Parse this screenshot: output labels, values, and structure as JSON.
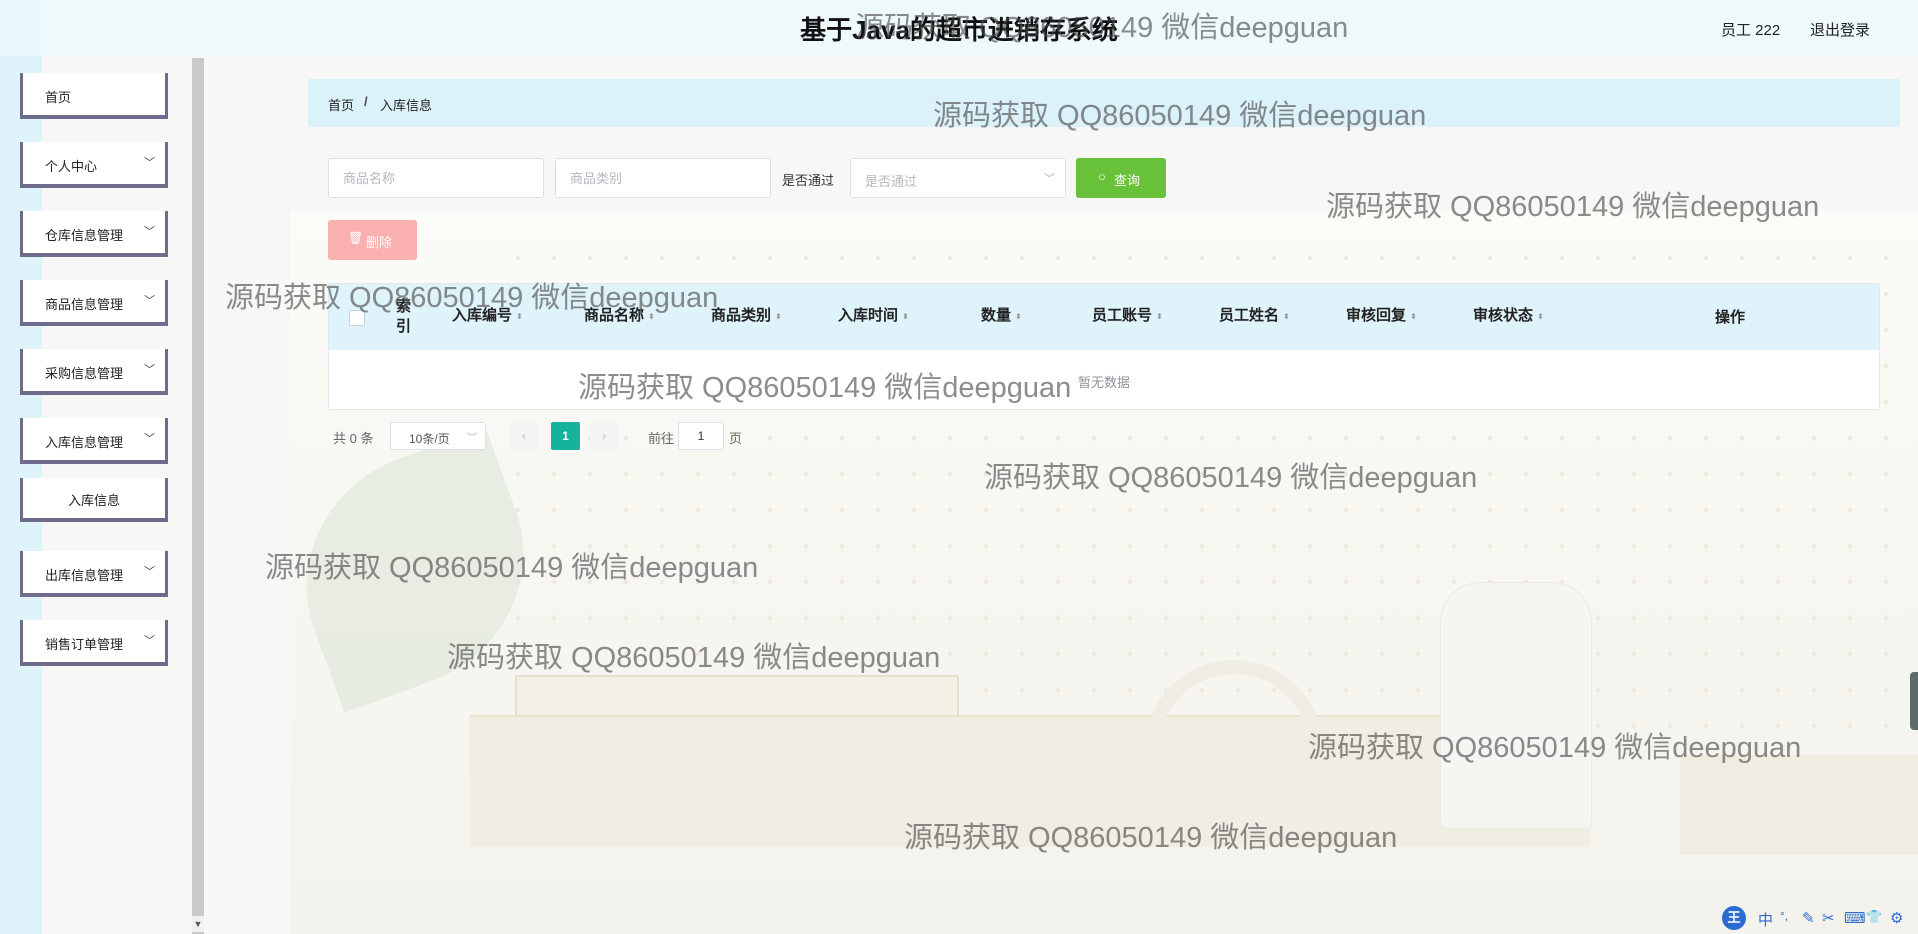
{
  "header": {
    "title": "基于Java的超市进销存系统",
    "user": "员工 222",
    "logout": "退出登录"
  },
  "sidebar": {
    "items": [
      {
        "label": "首页",
        "has_children": false
      },
      {
        "label": "个人中心",
        "has_children": true
      },
      {
        "label": "仓库信息管理",
        "has_children": true
      },
      {
        "label": "商品信息管理",
        "has_children": true
      },
      {
        "label": "采购信息管理",
        "has_children": true
      },
      {
        "label": "入库信息管理",
        "has_children": true,
        "expanded": true
      },
      {
        "label": "入库信息",
        "is_sub": true
      },
      {
        "label": "出库信息管理",
        "has_children": true
      },
      {
        "label": "销售订单管理",
        "has_children": true
      }
    ]
  },
  "breadcrumb": {
    "home": "首页",
    "separator": "/",
    "current": "入库信息"
  },
  "search": {
    "product_name_placeholder": "商品名称",
    "product_category_placeholder": "商品类别",
    "pass_label": "是否通过",
    "pass_select_placeholder": "是否通过",
    "query_button": "查询"
  },
  "actions": {
    "delete_button": "删除"
  },
  "table": {
    "index_header": "索引",
    "columns": [
      "入库编号",
      "商品名称",
      "商品类别",
      "入库时间",
      "数量",
      "员工账号",
      "员工姓名",
      "审核回复",
      "审核状态",
      "操作"
    ],
    "rows": [],
    "empty_text": "暂无数据"
  },
  "pagination": {
    "total": "共 0 条",
    "page_size": "10条/页",
    "current_page": "1",
    "goto_label": "前往",
    "goto_value": "1",
    "page_suffix": "页"
  },
  "watermark": {
    "text": "源码获取 QQ86050149 微信deepguan"
  },
  "ime": {
    "logo": "王",
    "lang": "中",
    "glyphs": [
      "°,",
      "✎",
      "✂",
      "⌨",
      "👕",
      "⚙"
    ]
  },
  "colors": {
    "primary_green": "#67c23a",
    "danger_disabled": "#fbb0b0",
    "page_active": "#16b39b",
    "header_bg": "#dff3fb",
    "sidebar_border": "#6f6b8c"
  }
}
